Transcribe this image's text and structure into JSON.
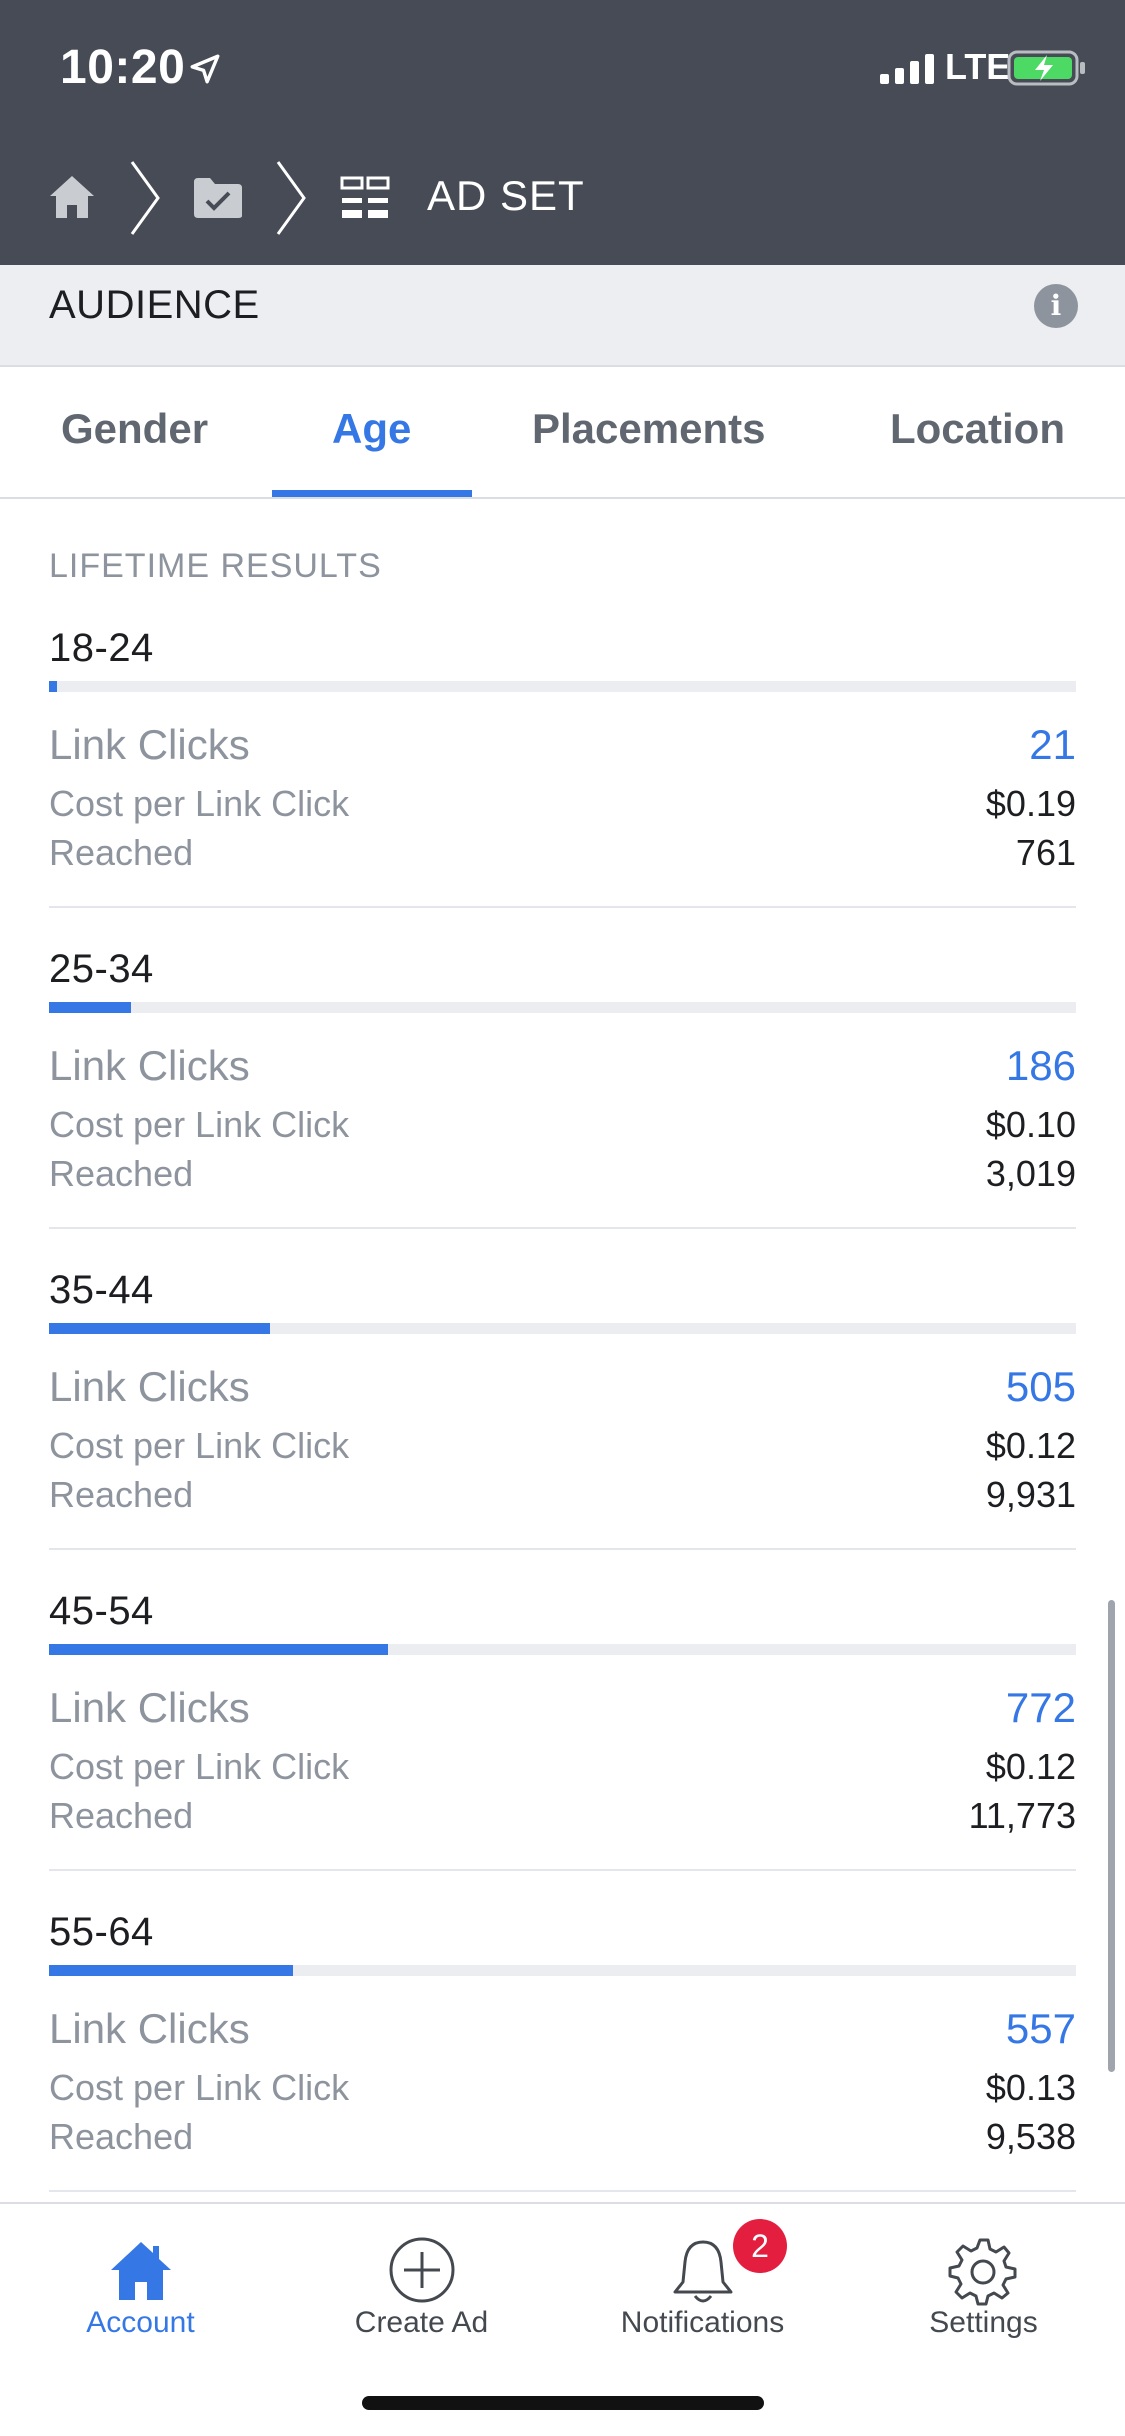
{
  "status_bar": {
    "time": "10:20",
    "carrier": "LTE"
  },
  "breadcrumb": {
    "current": "AD SET"
  },
  "audience": {
    "title": "AUDIENCE"
  },
  "tabs": [
    {
      "label": "Gender",
      "active": false
    },
    {
      "label": "Age",
      "active": true
    },
    {
      "label": "Placements",
      "active": false
    },
    {
      "label": "Location",
      "active": false
    }
  ],
  "lifetime_label": "LIFETIME RESULTS",
  "metric_labels": {
    "link_clicks": "Link Clicks",
    "cost_per_link_click": "Cost per Link Click",
    "reached": "Reached"
  },
  "age_groups": [
    {
      "range": "18-24",
      "link_clicks": "21",
      "cost": "$0.19",
      "reached": "761",
      "bar_fraction": 0.008
    },
    {
      "range": "25-34",
      "link_clicks": "186",
      "cost": "$0.10",
      "reached": "3,019",
      "bar_fraction": 0.08
    },
    {
      "range": "35-44",
      "link_clicks": "505",
      "cost": "$0.12",
      "reached": "9,931",
      "bar_fraction": 0.215
    },
    {
      "range": "45-54",
      "link_clicks": "772",
      "cost": "$0.12",
      "reached": "11,773",
      "bar_fraction": 0.33
    },
    {
      "range": "55-64",
      "link_clicks": "557",
      "cost": "$0.13",
      "reached": "9,538",
      "bar_fraction": 0.238
    }
  ],
  "bottom_nav": [
    {
      "label": "Account",
      "icon": "home-icon",
      "active": true
    },
    {
      "label": "Create Ad",
      "icon": "plus-circle-icon",
      "active": false
    },
    {
      "label": "Notifications",
      "icon": "bell-icon",
      "active": false,
      "badge": "2"
    },
    {
      "label": "Settings",
      "icon": "gear-icon",
      "active": false
    }
  ],
  "colors": {
    "header_bg": "#464b55",
    "accent": "#3578e5",
    "badge": "#e41e3f",
    "battery_green": "#4cd964"
  }
}
